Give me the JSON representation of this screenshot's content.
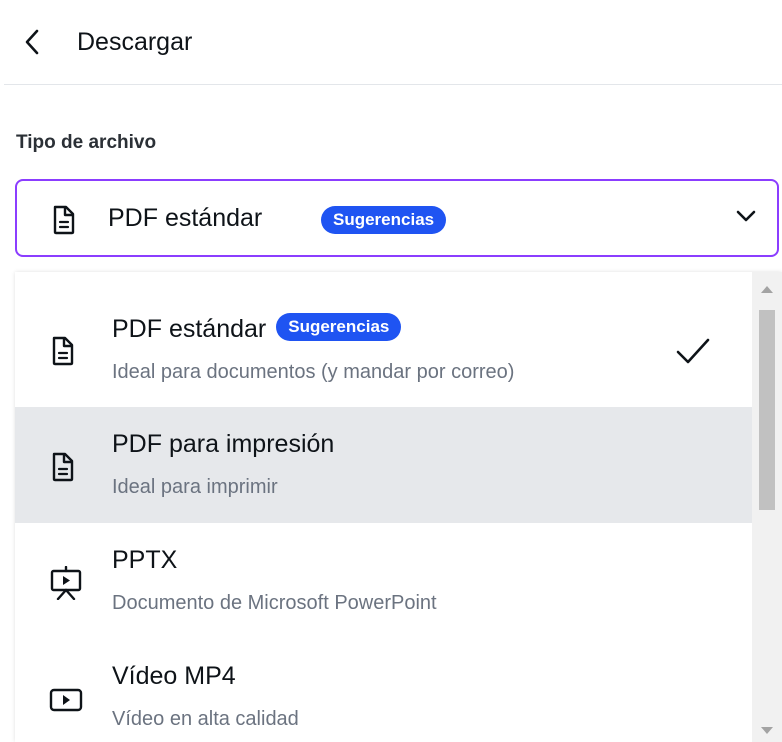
{
  "header": {
    "title": "Descargar"
  },
  "file_type": {
    "label": "Tipo de archivo",
    "selected": {
      "name": "PDF estándar",
      "badge": "Sugerencias"
    }
  },
  "options": [
    {
      "title": "PDF estándar",
      "badge": "Sugerencias",
      "subtitle": "Ideal para documentos (y mandar por correo)",
      "icon": "document-icon",
      "selected": true
    },
    {
      "title": "PDF para impresión",
      "subtitle": "Ideal para imprimir",
      "icon": "document-icon",
      "highlighted": true
    },
    {
      "title": "PPTX",
      "subtitle": "Documento de Microsoft PowerPoint",
      "icon": "presentation-icon"
    },
    {
      "title": "Vídeo MP4",
      "subtitle": "Vídeo en alta calidad",
      "icon": "video-icon"
    }
  ],
  "colors": {
    "accent": "#8b3dff",
    "badge": "#1f54f2",
    "hover": "#e6e8eb"
  }
}
